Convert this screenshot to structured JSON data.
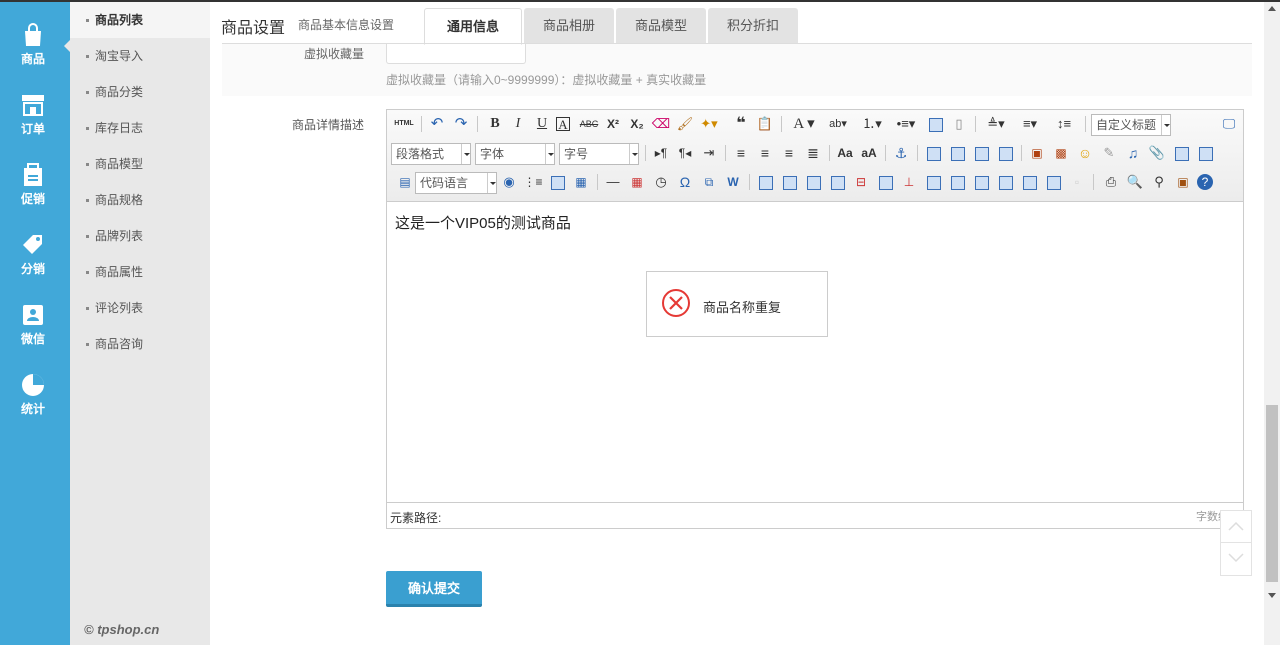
{
  "leftnav": {
    "items": [
      {
        "label": "商品",
        "icon": "shopping-bag-icon"
      },
      {
        "label": "订单",
        "icon": "storefront-icon"
      },
      {
        "label": "促销",
        "icon": "promotion-icon"
      },
      {
        "label": "分销",
        "icon": "tag-icon"
      },
      {
        "label": "微信",
        "icon": "wechat-card-icon"
      },
      {
        "label": "统计",
        "icon": "pie-chart-icon"
      }
    ]
  },
  "submenu": {
    "items": [
      {
        "label": "商品列表",
        "active": true
      },
      {
        "label": "淘宝导入"
      },
      {
        "label": "商品分类"
      },
      {
        "label": "库存日志"
      },
      {
        "label": "商品模型"
      },
      {
        "label": "商品规格"
      },
      {
        "label": "品牌列表"
      },
      {
        "label": "商品属性"
      },
      {
        "label": "评论列表"
      },
      {
        "label": "商品咨询"
      }
    ],
    "copyright": "© tpshop.cn"
  },
  "header": {
    "title": "商品设置",
    "subtitle": "商品基本信息设置"
  },
  "tabs": [
    {
      "label": "通用信息",
      "active": true
    },
    {
      "label": "商品相册"
    },
    {
      "label": "商品模型"
    },
    {
      "label": "积分折扣"
    }
  ],
  "form": {
    "virtual_fav_label": "虚拟收藏量",
    "virtual_fav_tip": "虚拟收藏量（请输入0~9999999）：虚拟收藏量 + 真实收藏量",
    "desc_label": "商品详情描述"
  },
  "editor": {
    "html_btn": "HTML",
    "heading_select": "自定义标题",
    "paragraph_select": "段落格式",
    "font_select": "字体",
    "size_select": "字号",
    "code_select": "代码语言",
    "content": "这是一个VIP05的测试商品",
    "path_label": "元素路径:",
    "wordcount_label": "字数统计"
  },
  "toast": {
    "message": "商品名称重复",
    "icon": "error-circle-icon",
    "color": "#e53935"
  },
  "submit_label": "确认提交",
  "colors": {
    "nav_bg": "#41a8d9",
    "submenu_bg": "#e8e8e8",
    "accent": "#3a9fd0"
  }
}
